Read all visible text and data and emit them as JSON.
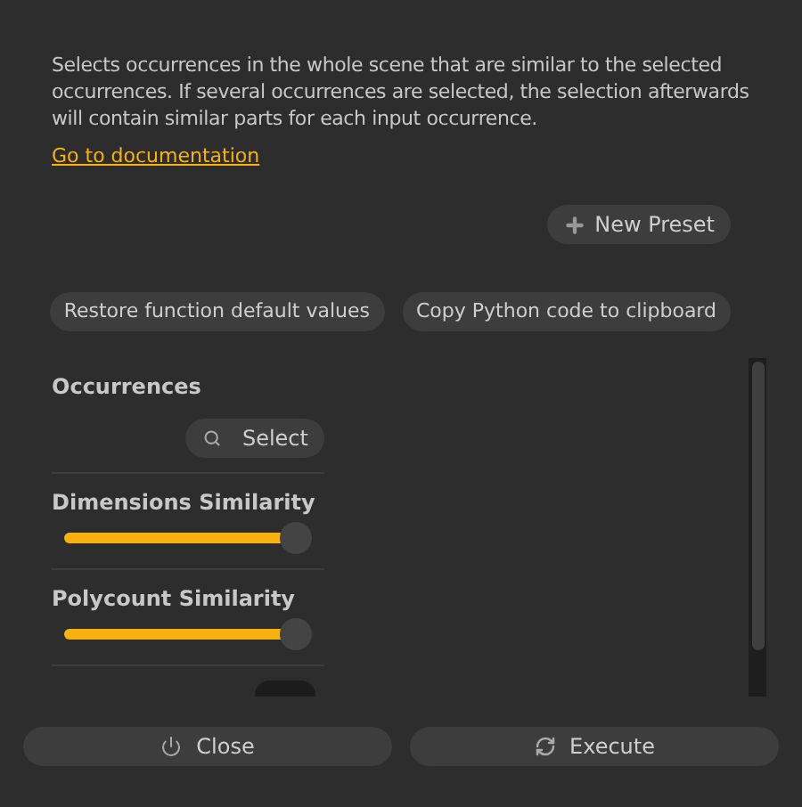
{
  "description": "Selects occurrences in the whole scene that are similar to the selected occurrences. If several occurrences are selected, the selection afterwards will contain similar parts for each input occurrence.",
  "documentation_link": "Go to documentation",
  "new_preset_button": "New Preset",
  "action_buttons": [
    "Restore function default values",
    "Copy Python code to clipboard"
  ],
  "parameters": [
    {
      "kind": "selector",
      "label": "Occurrences",
      "button": "Select"
    },
    {
      "kind": "slider",
      "label": "Dimensions Similarity",
      "level": 1
    },
    {
      "kind": "slider",
      "label": "Polycount Similarity",
      "level": 1
    },
    {
      "kind": "toggle",
      "on": false
    }
  ],
  "footer_buttons": [
    {
      "kind": "close",
      "label": "Close"
    },
    {
      "kind": "execute",
      "label": "Execute"
    }
  ]
}
